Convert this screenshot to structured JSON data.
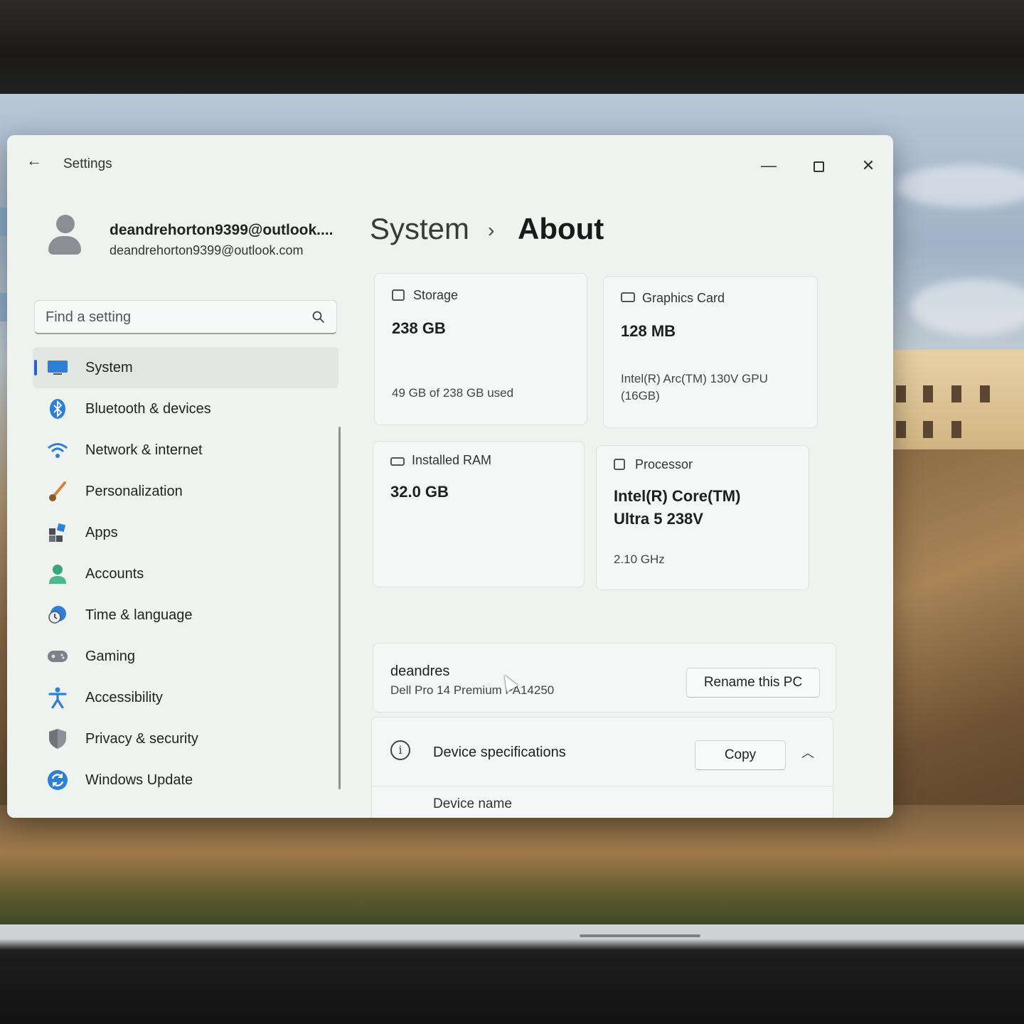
{
  "window": {
    "title": "Settings",
    "back_label": "←",
    "minimize_label": "—",
    "close_label": "✕"
  },
  "profile": {
    "name": "deandrehorton9399@outlook....",
    "email": "deandrehorton9399@outlook.com"
  },
  "search": {
    "placeholder": "Find a setting"
  },
  "nav": {
    "items": [
      {
        "label": "System",
        "icon": "monitor-icon",
        "active": true
      },
      {
        "label": "Bluetooth & devices",
        "icon": "bluetooth-icon"
      },
      {
        "label": "Network & internet",
        "icon": "wifi-icon"
      },
      {
        "label": "Personalization",
        "icon": "brush-icon"
      },
      {
        "label": "Apps",
        "icon": "apps-icon"
      },
      {
        "label": "Accounts",
        "icon": "person-icon"
      },
      {
        "label": "Time & language",
        "icon": "clock-globe-icon"
      },
      {
        "label": "Gaming",
        "icon": "gamepad-icon"
      },
      {
        "label": "Accessibility",
        "icon": "accessibility-icon"
      },
      {
        "label": "Privacy & security",
        "icon": "shield-icon"
      },
      {
        "label": "Windows Update",
        "icon": "update-icon"
      }
    ]
  },
  "header": {
    "parent": "System",
    "separator": "›",
    "current": "About"
  },
  "cards": {
    "storage": {
      "label": "Storage",
      "value": "238 GB",
      "sub": "49 GB of 238 GB used"
    },
    "gpu": {
      "label": "Graphics Card",
      "value": "128 MB",
      "sub1": "Intel(R) Arc(TM) 130V GPU",
      "sub2": "(16GB)"
    },
    "ram": {
      "label": "Installed RAM",
      "value": "32.0 GB"
    },
    "cpu": {
      "label": "Processor",
      "value1": "Intel(R) Core(TM)",
      "value2": "Ultra 5 238V",
      "sub": "2.10 GHz"
    }
  },
  "pc": {
    "name": "deandres",
    "model": "Dell Pro 14 Premium PA14250",
    "rename_label": "Rename this PC"
  },
  "device_specs": {
    "info_glyph": "i",
    "title": "Device specifications",
    "copy_label": "Copy",
    "chevron": "︿",
    "first_row_label": "Device name"
  },
  "colors": {
    "accent": "#2563c9",
    "window_bg": "#eef3f0"
  }
}
